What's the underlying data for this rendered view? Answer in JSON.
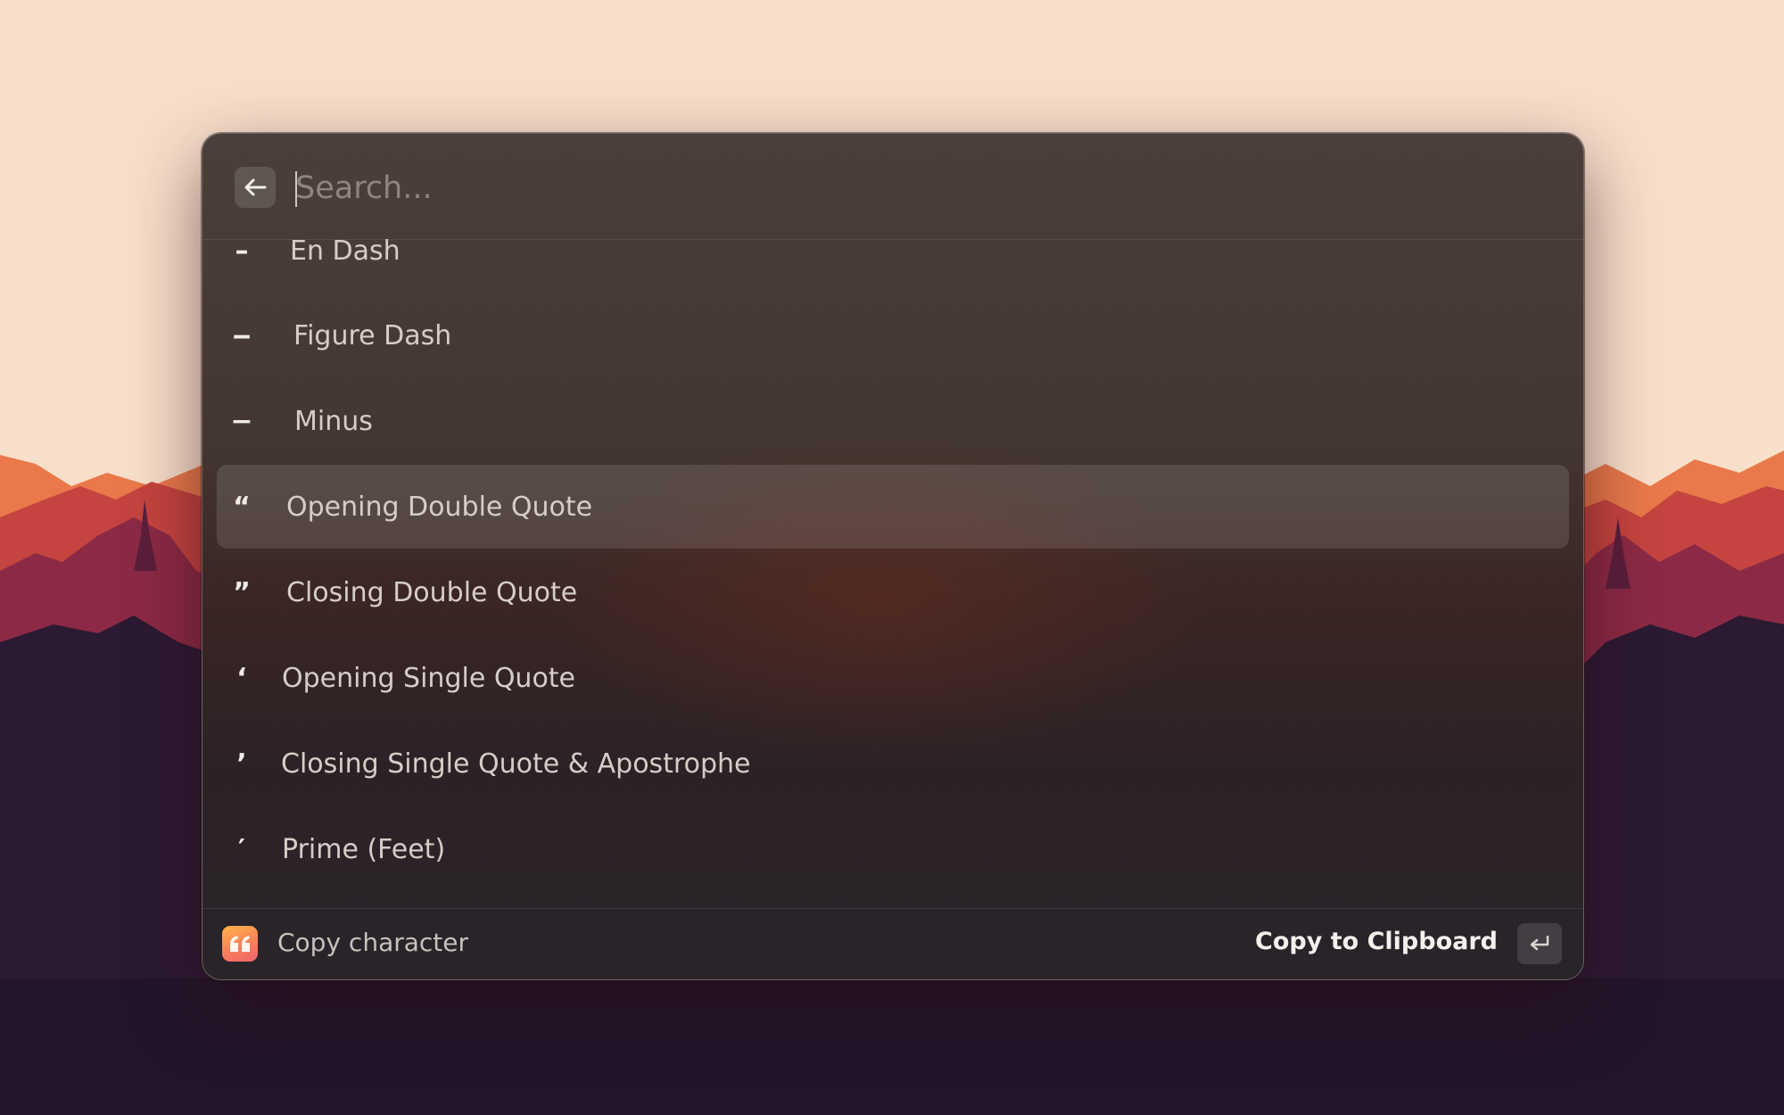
{
  "search": {
    "placeholder": "Search...",
    "value": ""
  },
  "list": {
    "items": [
      {
        "glyph": "–",
        "label": "En Dash"
      },
      {
        "glyph": "‒",
        "label": "Figure Dash"
      },
      {
        "glyph": "−",
        "label": "Minus"
      },
      {
        "glyph": "“",
        "label": "Opening Double Quote",
        "selected": true
      },
      {
        "glyph": "”",
        "label": "Closing Double Quote"
      },
      {
        "glyph": "‘",
        "label": "Opening Single Quote"
      },
      {
        "glyph": "’",
        "label": "Closing Single Quote & Apostrophe"
      },
      {
        "glyph": "′",
        "label": "Prime (Feet)"
      }
    ]
  },
  "footer": {
    "extension_title": "Copy character",
    "extension_icon": "quote-icon",
    "primary_action": "Copy to Clipboard",
    "shortcut_icon": "return-key-icon"
  },
  "colors": {
    "wallpaper_sky": "#f8dfca",
    "selection": "rgba(255,255,255,0.12)",
    "extension_icon_gradient": [
      "#ffb347",
      "#f0646b"
    ]
  }
}
